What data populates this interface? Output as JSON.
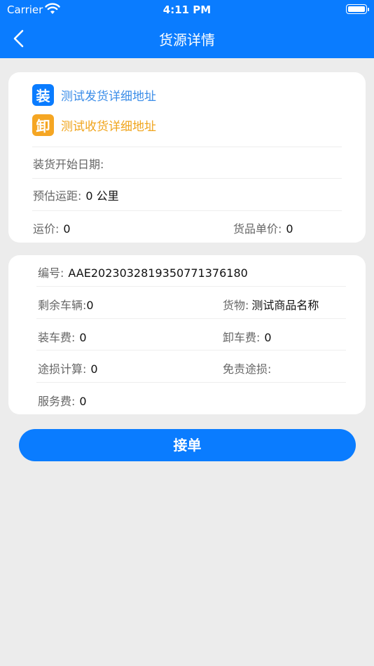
{
  "status": {
    "carrier": "Carrier",
    "time": "4:11 PM"
  },
  "nav": {
    "title": "货源详情"
  },
  "route": {
    "load_badge": "装",
    "load_address": "测试发货详细地址",
    "unload_badge": "卸",
    "unload_address": "测试收货详细地址"
  },
  "info": {
    "start_date_label": "装货开始日期:",
    "start_date_value": "",
    "distance_label": "预估运距:",
    "distance_value": "0 公里",
    "freight_label": "运价:",
    "freight_value": "0",
    "unit_price_label": "货品单价:",
    "unit_price_value": "0"
  },
  "detail": {
    "number_label": "编号:",
    "number_value": "AAE2023032819350771376180",
    "vehicles_label": "剩余车辆:",
    "vehicles_value": "0",
    "goods_label": "货物:",
    "goods_value": "测试商品名称",
    "loading_fee_label": "装车费:",
    "loading_fee_value": "0",
    "unloading_fee_label": "卸车费:",
    "unloading_fee_value": "0",
    "loss_calc_label": "途损计算:",
    "loss_calc_value": "0",
    "loss_exempt_label": "免责途损:",
    "loss_exempt_value": "",
    "service_fee_label": "服务费:",
    "service_fee_value": "0"
  },
  "action": {
    "accept_label": "接单"
  },
  "colors": {
    "primary": "#0a7cff",
    "unload_accent": "#f5a623",
    "background": "#ececec"
  }
}
